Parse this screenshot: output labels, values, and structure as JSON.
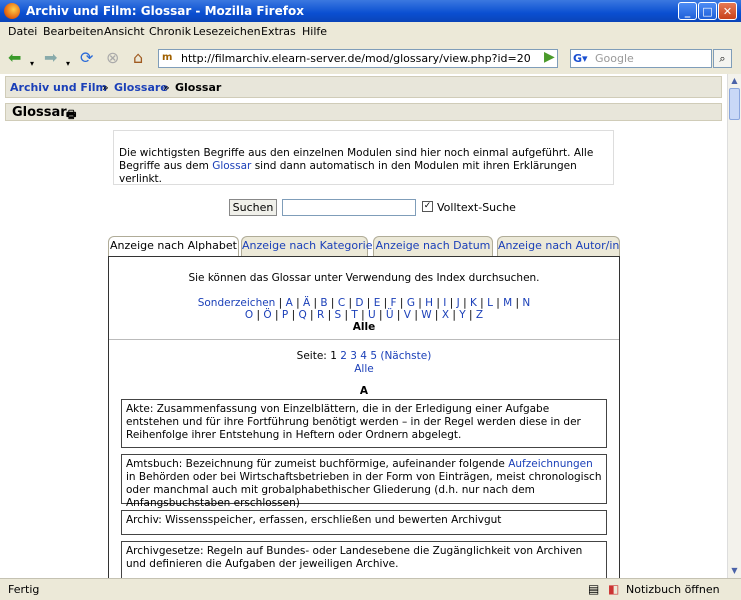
{
  "window": {
    "title": "Archiv und Film: Glossar - Mozilla Firefox"
  },
  "menu": [
    "Datei",
    "Bearbeiten",
    "Ansicht",
    "Chronik",
    "Lesezeichen",
    "Extras",
    "Hilfe"
  ],
  "address": {
    "url": "http://filmarchiv.elearn-server.de/mod/glossary/view.php?id=20"
  },
  "search": {
    "placeholder": "Google"
  },
  "breadcrumb": {
    "home": "Archiv und Film",
    "sep": "»",
    "mid": "Glossare",
    "current": "Glossar"
  },
  "page": {
    "heading": "Glossar",
    "intro_pre": "Die wichtigsten Begriffe aus den einzelnen Modulen sind hier noch einmal aufgeführt. Alle Begriffe aus dem ",
    "intro_link": "Glossar",
    "intro_post": " sind dann automatisch in den Modulen mit ihren Erklärungen verlinkt.",
    "search_button": "Suchen",
    "search_value": "",
    "fulltext_label": "Volltext-Suche",
    "fulltext_checked": true,
    "tabs": [
      "Anzeige nach Alphabet",
      "Anzeige nach Kategorie",
      "Anzeige nach Datum",
      "Anzeige nach Autor/in"
    ],
    "index_info": "Sie können das Glossar unter Verwendung des Index durchsuchen.",
    "alpha_row1": [
      "Sonderzeichen",
      "A",
      "Ä",
      "B",
      "C",
      "D",
      "E",
      "F",
      "G",
      "H",
      "I",
      "J",
      "K",
      "L",
      "M",
      "N"
    ],
    "alpha_row2": [
      "O",
      "Ö",
      "P",
      "Q",
      "R",
      "S",
      "T",
      "U",
      "Ü",
      "V",
      "W",
      "X",
      "Y",
      "Z"
    ],
    "alle": "Alle",
    "pages_label": "Seite:",
    "pages": [
      "1",
      "2",
      "3",
      "4",
      "5"
    ],
    "next_label": "(Nächste)",
    "pages_alle": "Alle",
    "letter": "A",
    "entries": [
      {
        "text": "Akte: Zusammenfassung von Einzelblättern, die in der Erledigung einer Aufgabe entstehen und für ihre Fortführung benötigt werden – in der Regel werden diese in der Reihenfolge ihrer Entstehung in Heftern oder Ordnern abgelegt."
      },
      {
        "pre": "Amtsbuch: Bezeichnung für zumeist buchförmige, aufeinander folgende ",
        "link": "Aufzeichnungen",
        "post": " in Behörden oder bei Wirtschaftsbetrieben in der Form von Einträgen, meist chronologisch oder manchmal auch mit grobalphabethischer Gliederung (d.h. nur nach dem Anfangsbuchstaben erschlossen)"
      },
      {
        "text": "Archiv: Wissensspeicher, erfassen, erschließen und bewerten Archivgut"
      },
      {
        "text": "Archivgesetze: Regeln auf Bundes- oder Landesebene die Zugänglichkeit von Archiven und definieren die Aufgaben der jeweiligen Archive."
      }
    ]
  },
  "status": {
    "text": "Fertig",
    "notebook": "Notizbuch öffnen"
  }
}
